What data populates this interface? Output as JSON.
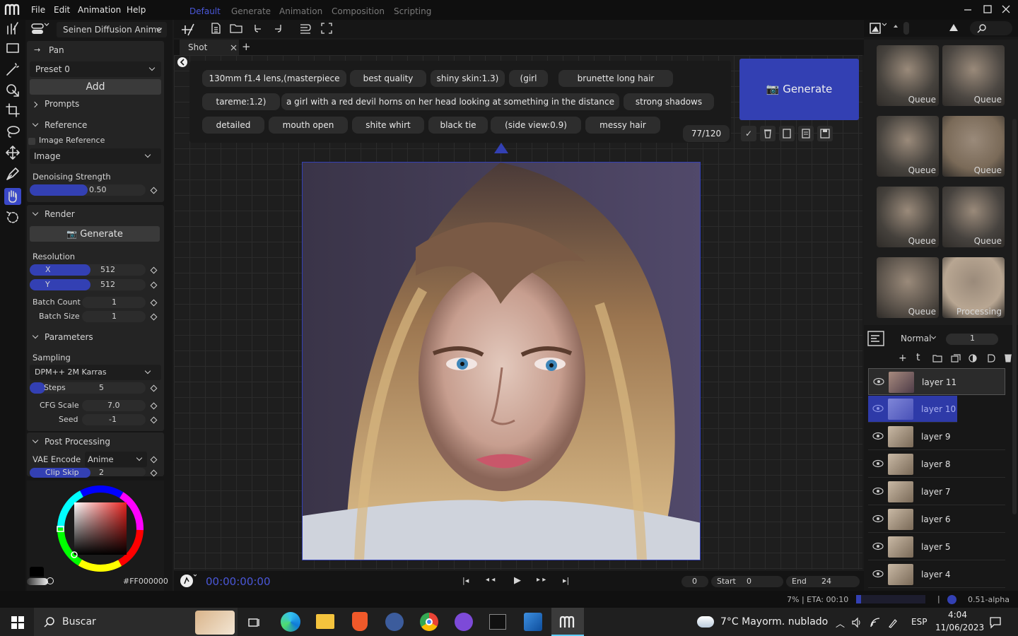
{
  "app": {
    "name": "Machine"
  },
  "menu": {
    "file": "File",
    "edit": "Edit",
    "animation": "Animation",
    "help": "Help"
  },
  "workspaces": {
    "default": "Default",
    "generate": "Generate",
    "animation": "Animation",
    "composition": "Composition",
    "scripting": "Scripting"
  },
  "model": {
    "selected": "Seinen Diffusion Anime"
  },
  "tools": {
    "pan_label": "Pan",
    "preset_value": "Preset 0",
    "add_label": "Add"
  },
  "sections": {
    "prompts": "Prompts",
    "reference": "Reference",
    "render": "Render",
    "parameters": "Parameters",
    "post_processing": "Post Processing"
  },
  "reference": {
    "image_reference_label": "Image Reference",
    "image_reference_checked": false,
    "image_select": "Image",
    "denoising_label": "Denoising Strength",
    "denoising_value": "0.50",
    "denoising_fraction": 0.5
  },
  "render": {
    "generate_label": "Generate",
    "resolution_label": "Resolution",
    "x_label": "X",
    "x_value": "512",
    "y_label": "Y",
    "y_value": "512",
    "batch_count_label": "Batch Count",
    "batch_count_value": "1",
    "batch_size_label": "Batch Size",
    "batch_size_value": "1"
  },
  "parameters": {
    "sampling_label": "Sampling",
    "sampler": "DPM++ 2M Karras",
    "steps_label": "Steps",
    "steps_value": "5",
    "cfg_label": "CFG Scale",
    "cfg_value": "7.0",
    "seed_label": "Seed",
    "seed_value": "-1"
  },
  "post_processing": {
    "vae_label": "VAE Encode",
    "vae_value": "Anime",
    "clip_skip_label": "Clip Skip",
    "clip_skip_value": "2"
  },
  "color": {
    "hex_label": "#FF000000",
    "primary": "#000000",
    "secondary": "#ffffff",
    "picked": "#e8231f"
  },
  "tabs": {
    "shot": "Shot",
    "add": "+"
  },
  "prompt_tags": [
    "130mm f1.4 lens,(masterpiece",
    "best quality",
    "shiny skin:1.3)",
    "(girl",
    "brunette long hair",
    "tareme:1.2)",
    "a girl with a red devil horns on her head looking at something in the distance",
    "strong shadows",
    "detailed",
    "mouth open",
    "shite whirt",
    "black tie",
    "(side view:0.9)",
    "messy hair"
  ],
  "token_count": "77/120",
  "generate_big": "Generate",
  "queue": {
    "label_queue": "Queue",
    "label_processing": "Processing"
  },
  "layers": {
    "blend_mode": "Normal",
    "opacity": "1",
    "items": [
      "layer 11",
      "layer 10",
      "layer 9",
      "layer 8",
      "layer 7",
      "layer 6",
      "layer 5",
      "layer 4"
    ]
  },
  "timeline": {
    "timecode": "00:00:00:00",
    "frame": "0",
    "start_label": "Start",
    "start_value": "0",
    "end_label": "End",
    "end_value": "24"
  },
  "status": {
    "progress_text": "7% | ETA: 00:10",
    "progress_fraction": 0.07,
    "version": "0.51-alpha"
  },
  "taskbar": {
    "search": "Buscar",
    "weather": "7°C  Mayorm. nublado",
    "lang": "ESP",
    "time": "4:04",
    "date": "11/06/2023"
  },
  "colors": {
    "accent": "#3a48c8",
    "bg": "#1b1b1b",
    "panel": "#242424"
  }
}
